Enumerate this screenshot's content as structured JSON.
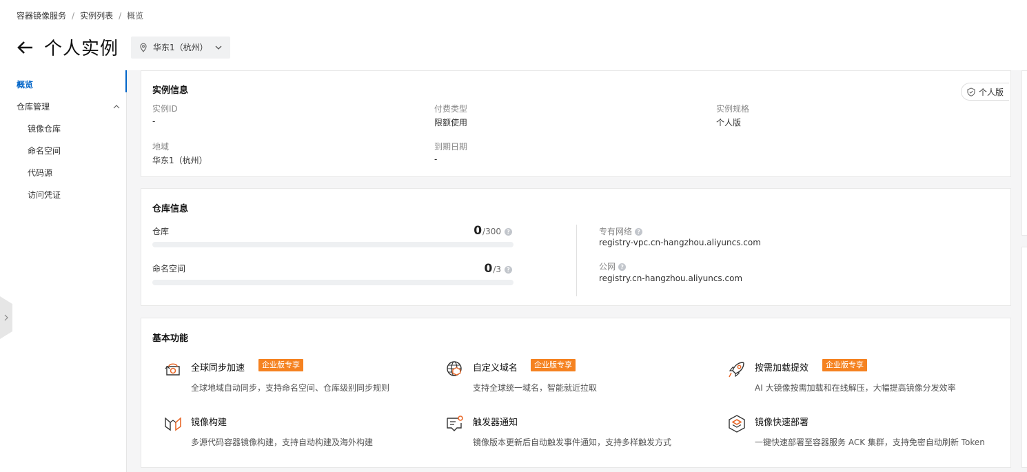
{
  "breadcrumb": {
    "level1": "容器镜像服务",
    "level2": "实例列表",
    "level3": "概览",
    "separator": "/"
  },
  "header": {
    "title": "个人实例",
    "region": "华东1（杭州）"
  },
  "sidebar": {
    "overview": "概览",
    "repo_group": "仓库管理",
    "items": [
      "镜像仓库",
      "命名空间",
      "代码源",
      "访问凭证"
    ]
  },
  "instance_info": {
    "title": "实例信息",
    "edition_badge": "个人版",
    "fields": {
      "instance_id_label": "实例ID",
      "instance_id_value": "-",
      "billing_label": "付费类型",
      "billing_value": "限额使用",
      "spec_label": "实例规格",
      "spec_value": "个人版",
      "region_label": "地域",
      "region_value": "华东1（杭州）",
      "expiry_label": "到期日期",
      "expiry_value": "-"
    }
  },
  "repo_info": {
    "title": "仓库信息",
    "repo": {
      "label": "仓库",
      "used": "0",
      "total": "/300",
      "fraction": 0.0
    },
    "namespace": {
      "label": "命名空间",
      "used": "0",
      "total": "/3",
      "fraction": 0.0
    },
    "vpc_label": "专有网络",
    "vpc_value": "registry-vpc.cn-hangzhou.aliyuncs.com",
    "public_label": "公网",
    "public_value": "registry.cn-hangzhou.aliyuncs.com"
  },
  "features": {
    "title": "基本功能",
    "enterprise_tag": "企业版专享",
    "items": [
      {
        "name": "全球同步加速",
        "desc": "全球地域自动同步，支持命名空间、仓库级别同步规则",
        "icon": "global-sync-icon"
      },
      {
        "name": "自定义域名",
        "desc": "支持全球统一域名，智能就近拉取",
        "icon": "globe-icon"
      },
      {
        "name": "按需加载提效",
        "desc": "AI 大镜像按需加载和在线解压，大幅提高镜像分发效率",
        "icon": "rocket-icon"
      },
      {
        "name": "镜像构建",
        "desc": "多源代码容器镜像构建，支持自动构建及海外构建",
        "icon": "build-icon"
      },
      {
        "name": "触发器通知",
        "desc": "镜像版本更新后自动触发事件通知，支持多样触发方式",
        "icon": "notification-icon"
      },
      {
        "name": "镜像快速部署",
        "desc": "一键快速部署至容器服务 ACK 集群，支持免密自动刷新 Token",
        "icon": "deploy-icon"
      }
    ]
  },
  "colors": {
    "accent": "#0064c8",
    "enterprise": "#f58220",
    "icon_orange": "#e8692a"
  }
}
